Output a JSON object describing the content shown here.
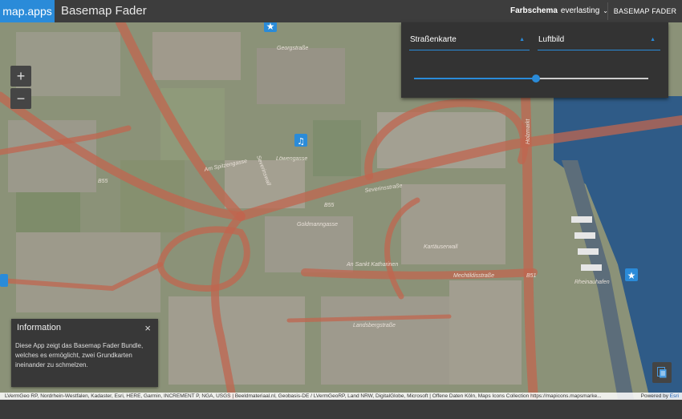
{
  "header": {
    "brand": "map.apps",
    "title": "Basemap Fader",
    "scheme_label": "Farbschema",
    "scheme_value": "everlasting",
    "fader_button": "BASEMAP FADER"
  },
  "zoom": {
    "in": "+",
    "out": "−"
  },
  "panel": {
    "left_basemap": "Straßenkarte",
    "right_basemap": "Luftbild",
    "fade_value": 0.52
  },
  "info": {
    "title": "Information",
    "close": "×",
    "body": "Diese App zeigt das Basemap Fader Bundle, welches es ermöglicht, zwei Grundkarten ineinander zu schmelzen."
  },
  "map_labels": {
    "georgstrasse": "Georgstraße",
    "loewengasse": "Löwengasse",
    "am_spitzengasse": "Am Spitzengasse",
    "severinswall": "Severinswall",
    "holzmarkt": "Holzmarkt",
    "rheinau": "Rheinauhafen",
    "kartaeuser": "Kartäuserwall",
    "mechtildisstrasse": "Mechtildisstraße",
    "severinsstrasse": "Severinsstraße",
    "landsbergstrasse": "Landsbergstraße",
    "goldmanngasse": "Goldmanngasse",
    "an_sankt_katharinen": "An Sankt Katharinen",
    "b55a": "B55",
    "b55b": "B55",
    "b51": "B51"
  },
  "attribution": {
    "text": "LVermGeo RP, Nordrhein-Westfalen, Kadaster, Esri, HERE, Garmin, INCREMENT P, NGA, USGS | Beeldmateriaal.nl, Geobasis-DE / LVermGeoRP, Land NRW, DigitalGlobe, Microsoft | Offene Daten Köln, Maps Icons Collection https://mapicons.mapsmarke...",
    "powered_by": "Powered by",
    "esri": "Esri"
  },
  "icons": [
    "star-marker-icon",
    "music-marker-icon",
    "print-icon"
  ],
  "colors": {
    "accent": "#2a8bd9",
    "road": "#c0654f",
    "water": "#2f5b87",
    "map_base": "#8b9278"
  }
}
